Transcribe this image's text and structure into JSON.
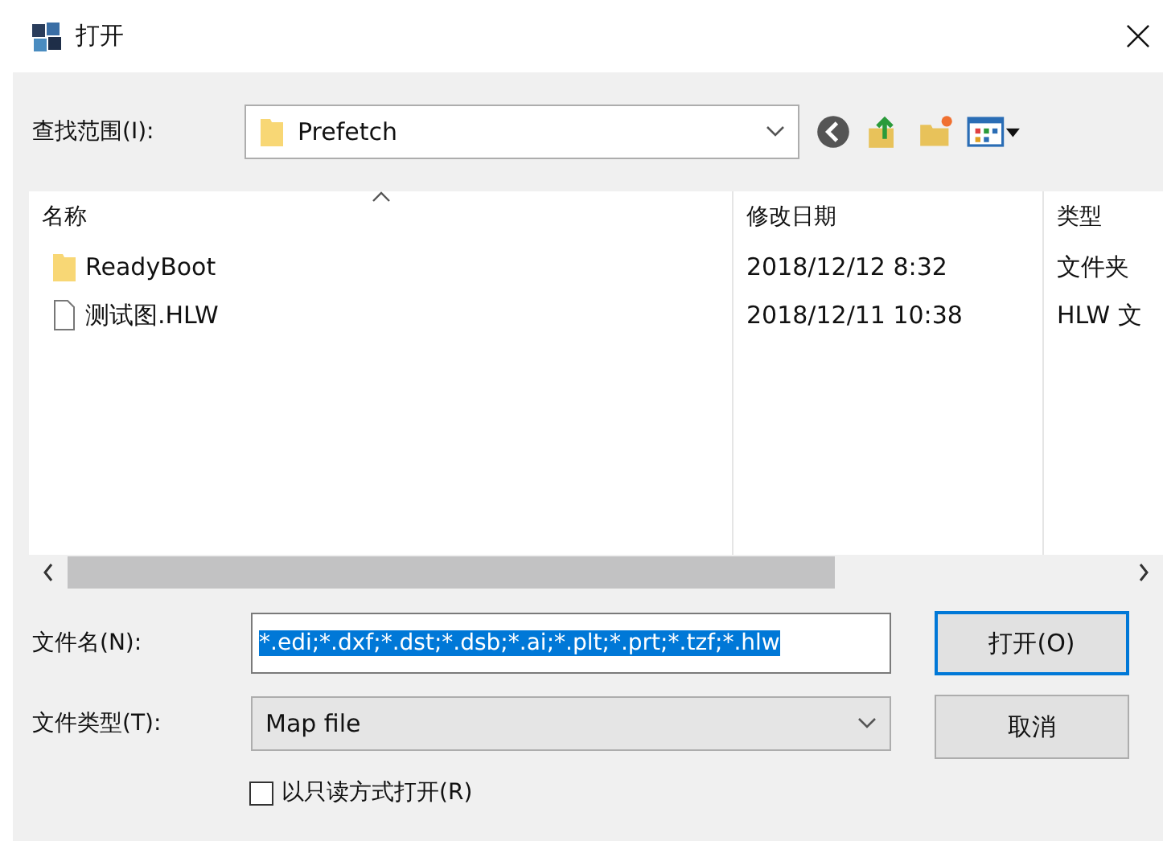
{
  "window": {
    "title": "打开"
  },
  "look_in": {
    "label": "查找范围(I):",
    "value": "Prefetch"
  },
  "file_list": {
    "columns": [
      "名称",
      "修改日期",
      "类型"
    ],
    "rows": [
      {
        "kind": "folder",
        "name": "ReadyBoot",
        "modified": "2018/12/12 8:32",
        "type": "文件夹"
      },
      {
        "kind": "file",
        "name": "测试图.HLW",
        "modified": "2018/12/11 10:38",
        "type": "HLW 文"
      }
    ]
  },
  "file_name": {
    "label": "文件名(N):",
    "value": "*.edi;*.dxf;*.dst;*.dsb;*.ai;*.plt;*.prt;*.tzf;*.hlw"
  },
  "file_type": {
    "label": "文件类型(T):",
    "value": "Map file"
  },
  "read_only": {
    "label": "以只读方式打开(R)",
    "checked": false
  },
  "buttons": [
    "打开(O)",
    "取消"
  ]
}
